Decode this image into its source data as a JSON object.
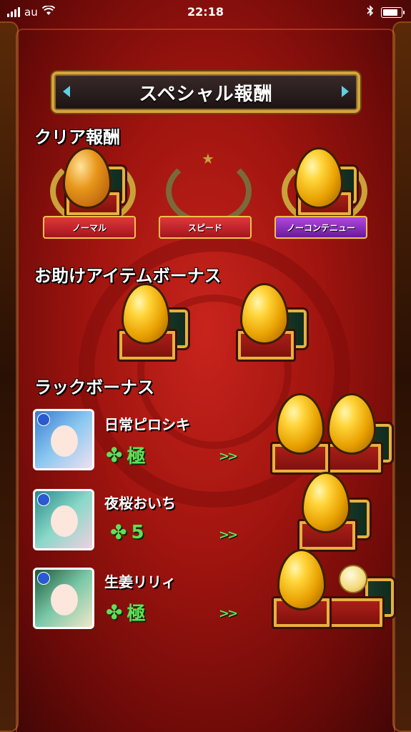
{
  "status_bar": {
    "carrier": "au",
    "time": "22:18"
  },
  "title": "スペシャル報酬",
  "sections": {
    "clear": "クリア報酬",
    "assist": "お助けアイテムボーナス",
    "luck": "ラックボーナス"
  },
  "medals": [
    {
      "label": "ノーマル",
      "achieved": true
    },
    {
      "label": "スピード",
      "achieved": false
    },
    {
      "label": "ノーコンテニュー",
      "achieved": true
    }
  ],
  "luck_rows": [
    {
      "name": "日常ピロシキ",
      "luck": "極",
      "reward_count": 2
    },
    {
      "name": "夜桜おいち",
      "luck": "5",
      "reward_count": 1
    },
    {
      "name": "生姜リリィ",
      "luck": "極",
      "reward_count": 2
    }
  ],
  "colors": {
    "accent_gold": "#d6a43a",
    "luck_green": "#5fe05a",
    "ribbon_red": "#e0383a",
    "ribbon_purple": "#b048e0"
  }
}
